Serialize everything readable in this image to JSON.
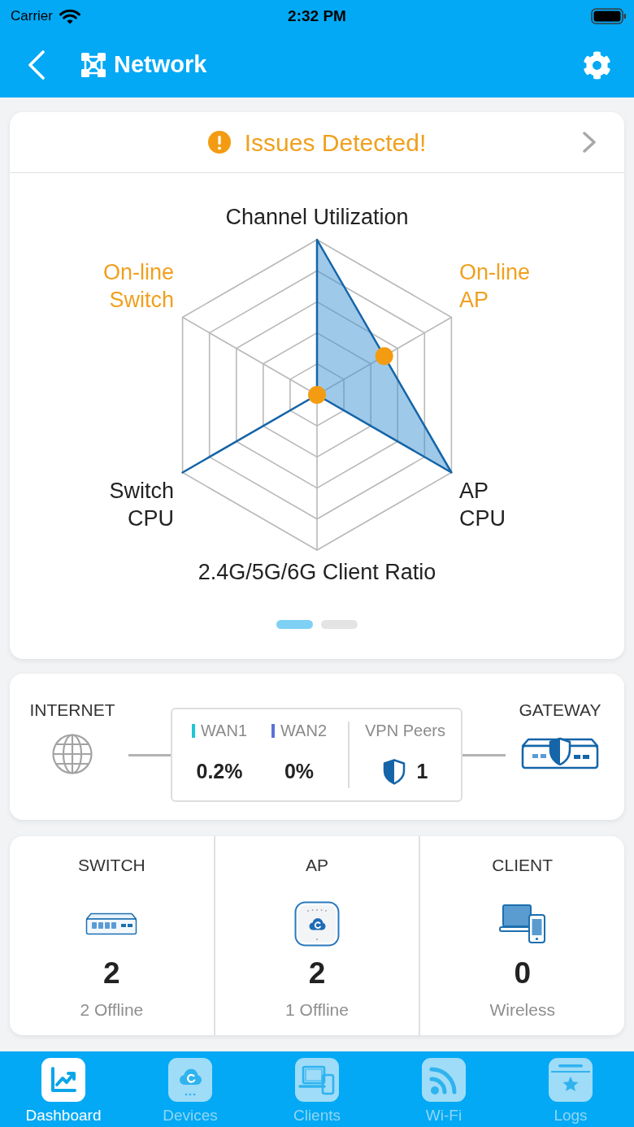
{
  "status_bar": {
    "carrier": "Carrier",
    "time": "2:32 PM"
  },
  "nav_bar": {
    "title": "Network"
  },
  "issues_card": {
    "title": "Issues Detected!",
    "radar": {
      "axes": [
        {
          "label": "Channel Utilization",
          "alert": false
        },
        {
          "label": "On-line AP",
          "alert": true
        },
        {
          "label": "AP CPU",
          "alert": false
        },
        {
          "label": "2.4G/5G/6G Client Ratio",
          "alert": false
        },
        {
          "label": "Switch CPU",
          "alert": false
        },
        {
          "label": "On-line Switch",
          "alert": true
        }
      ]
    },
    "pages": [
      {
        "selected": true
      },
      {
        "selected": false
      }
    ]
  },
  "wan_card": {
    "internet_label": "INTERNET",
    "wans": [
      {
        "name": "WAN1",
        "color": "#1ec5d6",
        "value": "0.2%"
      },
      {
        "name": "WAN2",
        "color": "#5a72d8",
        "value": "0%"
      }
    ],
    "vpn": {
      "label": "VPN Peers",
      "value": "1"
    },
    "gateway_label": "GATEWAY"
  },
  "device_tiles": [
    {
      "kind": "switch",
      "title": "SWITCH",
      "count": "2",
      "detail": "2 Offline"
    },
    {
      "kind": "ap",
      "title": "AP",
      "count": "2",
      "detail": "1 Offline"
    },
    {
      "kind": "client",
      "title": "CLIENT",
      "count": "0",
      "detail": "Wireless"
    }
  ],
  "tabs": [
    {
      "kind": "dashboard",
      "label": "Dashboard",
      "selected": true
    },
    {
      "kind": "devices",
      "label": "Devices",
      "selected": false
    },
    {
      "kind": "clients",
      "label": "Clients",
      "selected": false
    },
    {
      "kind": "wifi",
      "label": "Wi-Fi",
      "selected": false
    },
    {
      "kind": "logs",
      "label": "Logs",
      "selected": false
    }
  ]
}
